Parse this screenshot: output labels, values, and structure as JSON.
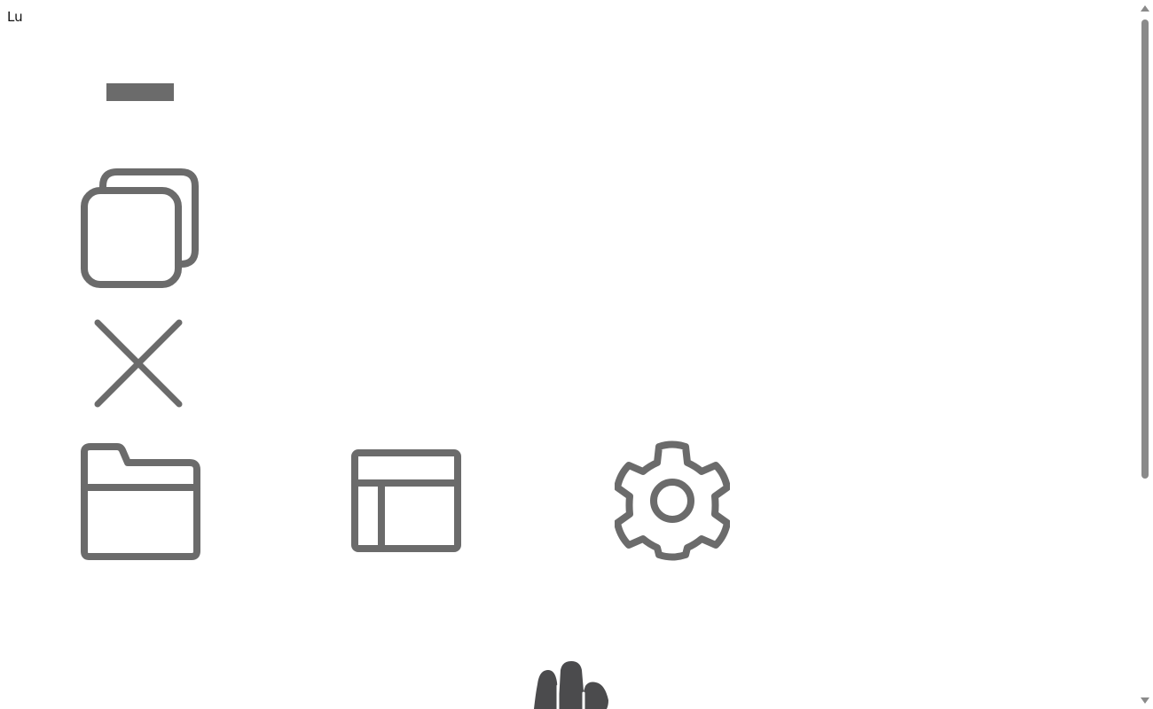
{
  "page": {
    "top_text": "Lu"
  },
  "icons": {
    "minimize": "minimize-icon",
    "restore": "restore-icon",
    "close": "close-icon",
    "folder": "folder-icon",
    "layout": "layout-icon",
    "settings": "gear-icon",
    "hand": "hand-icon"
  },
  "colors": {
    "icon_gray": "#6b6b6b",
    "hand_dark": "#4b4b4d",
    "scroll_gray": "#8a8a8a"
  }
}
